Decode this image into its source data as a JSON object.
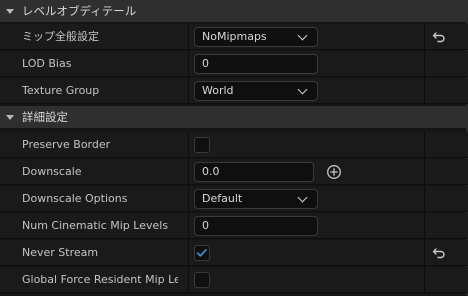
{
  "sections": {
    "level_of_detail": {
      "title": "レベルオブディテール"
    },
    "advanced": {
      "title": "詳細設定"
    }
  },
  "rows": {
    "mip_gen": {
      "label": "ミップ全般設定",
      "value": "NoMipmaps"
    },
    "lod_bias": {
      "label": "LOD Bias",
      "value": "0"
    },
    "texture_group": {
      "label": "Texture Group",
      "value": "World"
    },
    "preserve_border": {
      "label": "Preserve Border",
      "checked": false
    },
    "downscale": {
      "label": "Downscale",
      "value": "0.0"
    },
    "downscale_options": {
      "label": "Downscale Options",
      "value": "Default"
    },
    "num_cinematic_mip_levels": {
      "label": "Num Cinematic Mip Levels",
      "value": "0"
    },
    "never_stream": {
      "label": "Never Stream",
      "checked": true
    },
    "global_force_resident": {
      "label": "Global Force Resident Mip Le...",
      "checked": false
    }
  },
  "icons": {
    "reset": "reset-arrow-icon",
    "add": "plus-circle-icon",
    "section_arrow": "collapse-triangle-icon",
    "check": "checkmark-icon"
  },
  "colors": {
    "accent_check": "#3a8fd8",
    "background": "#151515",
    "row": "#1a1a1a",
    "section": "#2f2f2f"
  }
}
